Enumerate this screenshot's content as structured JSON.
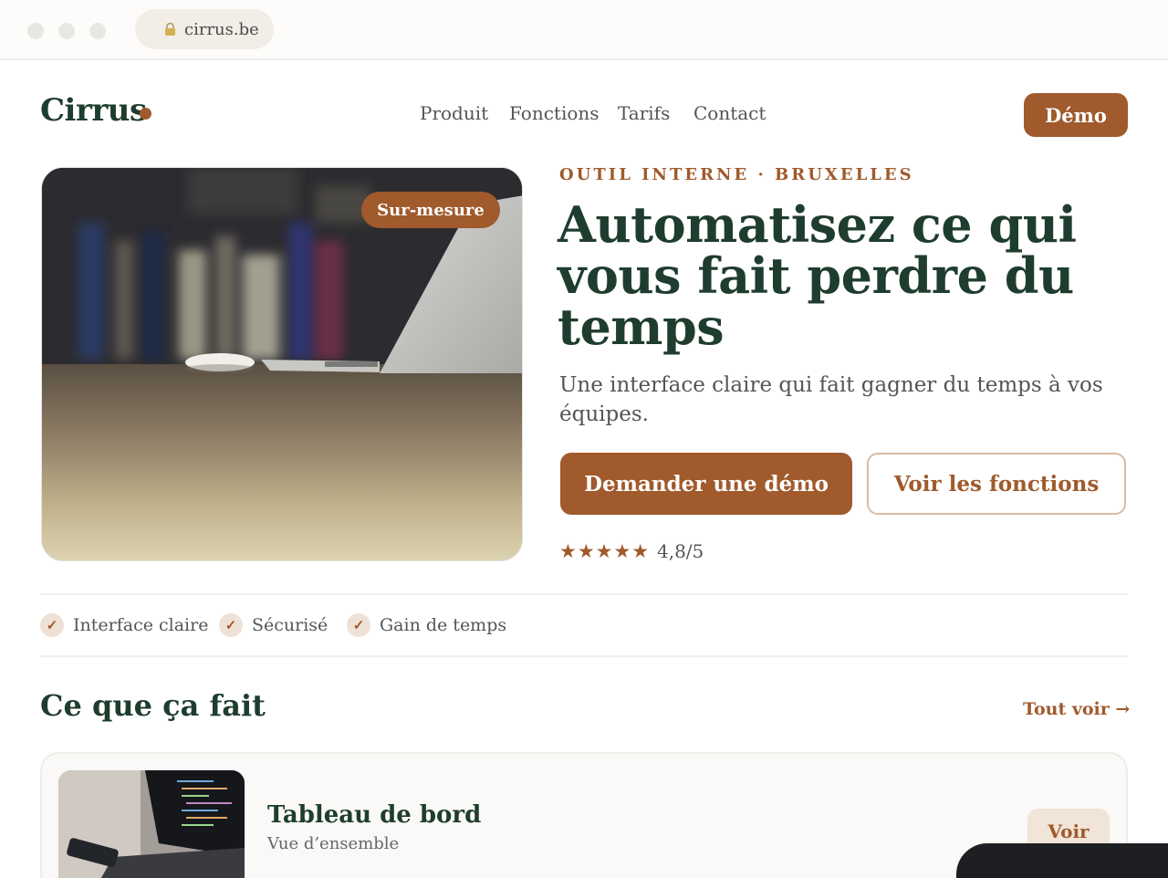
{
  "browser": {
    "url": "cirrus.be"
  },
  "header": {
    "logo": "Cirrus",
    "nav": [
      "Produit",
      "Fonctions",
      "Tarifs",
      "Contact"
    ],
    "demo_label": "Démo"
  },
  "hero": {
    "badge": "Sur-mesure",
    "eyebrow": "OUTIL INTERNE · BRUXELLES",
    "headline": "Automatisez ce qui vous fait perdre du temps",
    "subtitle": "Une interface claire qui fait gagner du temps à vos équipes.",
    "primary_cta": "Demander une démo",
    "secondary_cta": "Voir les fonctions",
    "stars": "★★★★★",
    "rating": "4,8/5"
  },
  "features": [
    {
      "label": "Interface claire"
    },
    {
      "label": "Sécurisé"
    },
    {
      "label": "Gain de temps"
    }
  ],
  "check_glyph": "✓",
  "section": {
    "title": "Ce que ça fait",
    "see_all": "Tout voir →",
    "cards": [
      {
        "title": "Tableau de bord",
        "subtitle": "Vue d’ensemble",
        "action": "Voir"
      }
    ]
  },
  "colors": {
    "accent": "#a05a2c",
    "brand": "#1f3d2e"
  }
}
